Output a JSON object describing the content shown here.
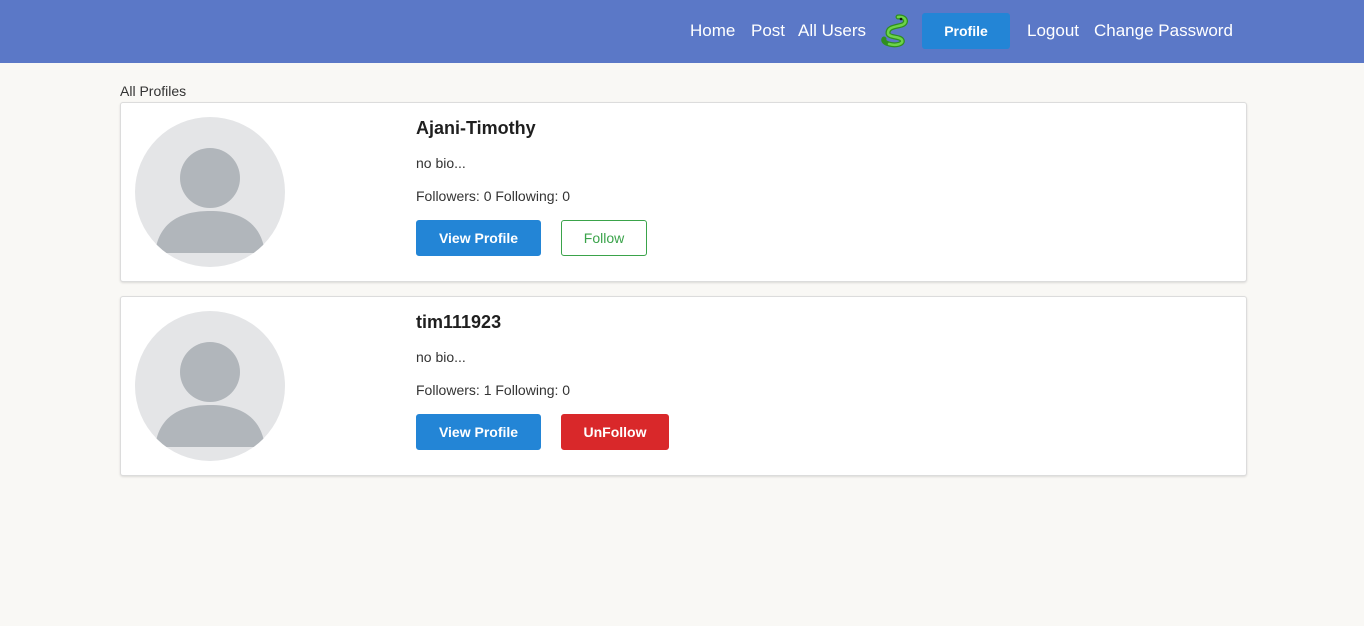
{
  "nav": {
    "home": "Home",
    "post": "Post",
    "all_users": "All Users",
    "logo_icon": "snake-icon",
    "profile": "Profile",
    "logout": "Logout",
    "change_password": "Change Password"
  },
  "section_title": "All Profiles",
  "profiles": [
    {
      "username": "Ajani-Timothy",
      "bio": "no bio...",
      "followers_label": "Followers:",
      "followers": "0",
      "following_label": "Following:",
      "following": "0",
      "view_label": "View Profile",
      "action_label": "Follow"
    },
    {
      "username": "tim111923",
      "bio": "no bio...",
      "followers_label": "Followers:",
      "followers": "1",
      "following_label": "Following:",
      "following": "0",
      "view_label": "View Profile",
      "action_label": "UnFollow"
    }
  ],
  "colors": {
    "navbar": "#5b78c7",
    "primary": "#2385d6",
    "follow": "#3aa34a",
    "unfollow": "#d9282a",
    "background": "#f9f8f5"
  }
}
